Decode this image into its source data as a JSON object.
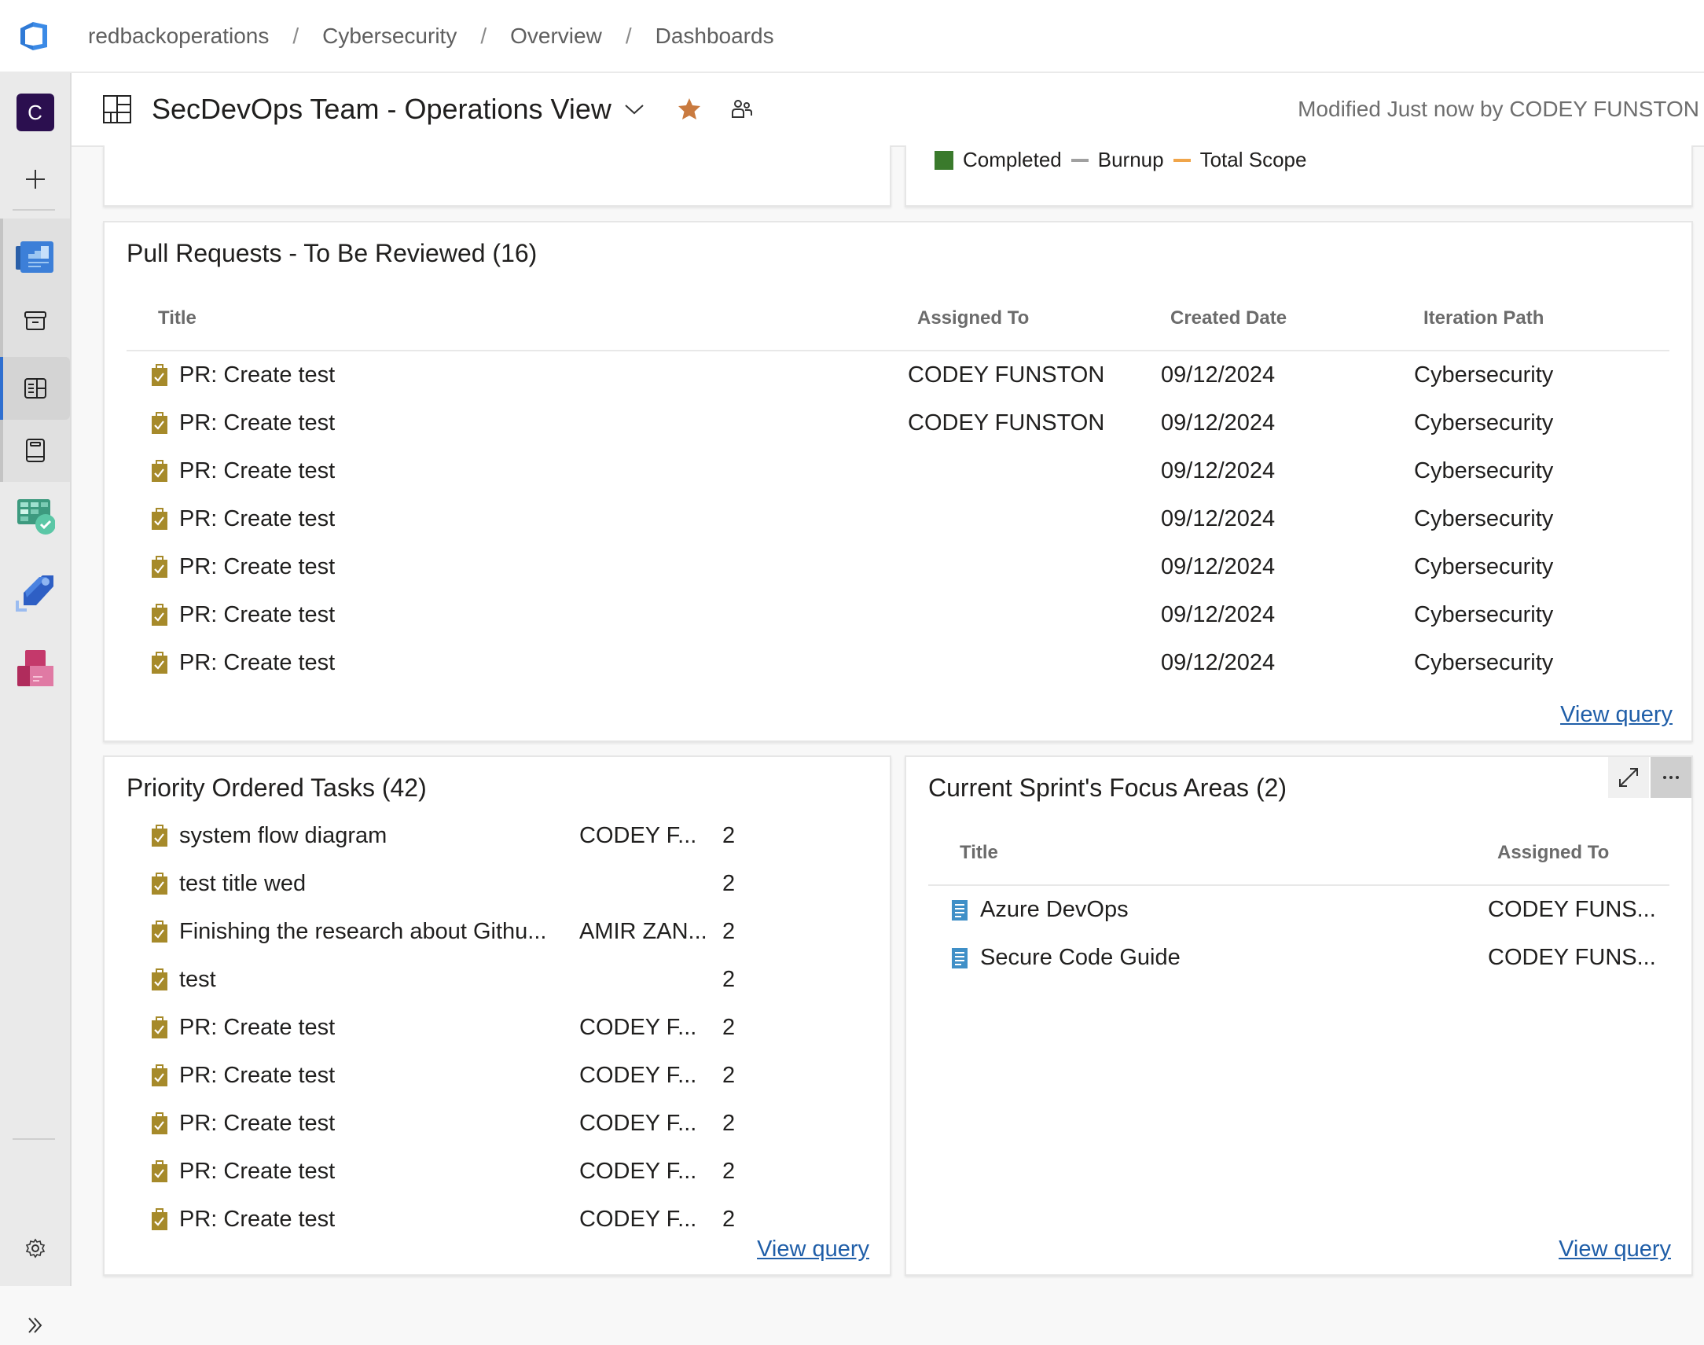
{
  "breadcrumb": [
    "redbackoperations",
    "Cybersecurity",
    "Overview",
    "Dashboards"
  ],
  "sidebar": {
    "avatar_letter": "C",
    "items": [
      {
        "name": "new-project",
        "icon": "plus-icon"
      },
      {
        "name": "overview",
        "icon": "overview-icon"
      },
      {
        "name": "summary",
        "icon": "summary-icon"
      },
      {
        "name": "dashboards",
        "icon": "dashboards-icon",
        "active": true
      },
      {
        "name": "wiki",
        "icon": "wiki-icon"
      },
      {
        "name": "boards",
        "icon": "boards-icon"
      },
      {
        "name": "pipelines",
        "icon": "pipelines-icon"
      },
      {
        "name": "artifacts",
        "icon": "artifacts-icon"
      },
      {
        "name": "project-settings",
        "icon": "gear-icon"
      },
      {
        "name": "expand",
        "icon": "double-chevron-right-icon"
      }
    ]
  },
  "header": {
    "title": "SecDevOps Team - Operations View",
    "modified": "Modified Just now by CODEY FUNSTON",
    "star_color": "#c97a3f"
  },
  "burnup_legend": [
    {
      "label": "Completed",
      "type": "square",
      "color": "#3a7a2c"
    },
    {
      "label": "Burnup",
      "type": "line",
      "color": "#a0a0a0"
    },
    {
      "label": "Total Scope",
      "type": "line",
      "color": "#f0a54a"
    }
  ],
  "pull_requests": {
    "title": "Pull Requests - To Be Reviewed (16)",
    "columns": [
      "Title",
      "Assigned To",
      "Created Date",
      "Iteration Path"
    ],
    "rows": [
      {
        "title": "PR: Create test",
        "assigned": "CODEY FUNSTON",
        "date": "09/12/2024",
        "iteration": "Cybersecurity"
      },
      {
        "title": "PR: Create test",
        "assigned": "CODEY FUNSTON",
        "date": "09/12/2024",
        "iteration": "Cybersecurity"
      },
      {
        "title": "PR: Create test",
        "assigned": "",
        "date": "09/12/2024",
        "iteration": "Cybersecurity"
      },
      {
        "title": "PR: Create test",
        "assigned": "",
        "date": "09/12/2024",
        "iteration": "Cybersecurity"
      },
      {
        "title": "PR: Create test",
        "assigned": "",
        "date": "09/12/2024",
        "iteration": "Cybersecurity"
      },
      {
        "title": "PR: Create test",
        "assigned": "",
        "date": "09/12/2024",
        "iteration": "Cybersecurity"
      },
      {
        "title": "PR: Create test",
        "assigned": "",
        "date": "09/12/2024",
        "iteration": "Cybersecurity"
      }
    ],
    "link": "View query"
  },
  "priority_tasks": {
    "title": "Priority Ordered Tasks (42)",
    "rows": [
      {
        "title": "system flow diagram",
        "assigned": "CODEY F...",
        "priority": "2"
      },
      {
        "title": "test title wed",
        "assigned": "",
        "priority": "2"
      },
      {
        "title": "Finishing the research about Githu...",
        "assigned": "AMIR ZAN...",
        "priority": "2"
      },
      {
        "title": "test",
        "assigned": "",
        "priority": "2"
      },
      {
        "title": "PR: Create test",
        "assigned": "CODEY F...",
        "priority": "2"
      },
      {
        "title": "PR: Create test",
        "assigned": "CODEY F...",
        "priority": "2"
      },
      {
        "title": "PR: Create test",
        "assigned": "CODEY F...",
        "priority": "2"
      },
      {
        "title": "PR: Create test",
        "assigned": "CODEY F...",
        "priority": "2"
      },
      {
        "title": "PR: Create test",
        "assigned": "CODEY F...",
        "priority": "2"
      }
    ],
    "link": "View query"
  },
  "focus_areas": {
    "title": "Current Sprint's Focus Areas (2)",
    "columns": [
      "Title",
      "Assigned To"
    ],
    "rows": [
      {
        "title": "Azure DevOps",
        "assigned": "CODEY FUNS..."
      },
      {
        "title": "Secure Code Guide",
        "assigned": "CODEY FUNS..."
      }
    ],
    "link": "View query"
  },
  "colors": {
    "task_icon": "#a68a2a",
    "epic_icon": "#3f8fc7",
    "link": "#1f5ea8",
    "accent": "#2f6fd0"
  }
}
